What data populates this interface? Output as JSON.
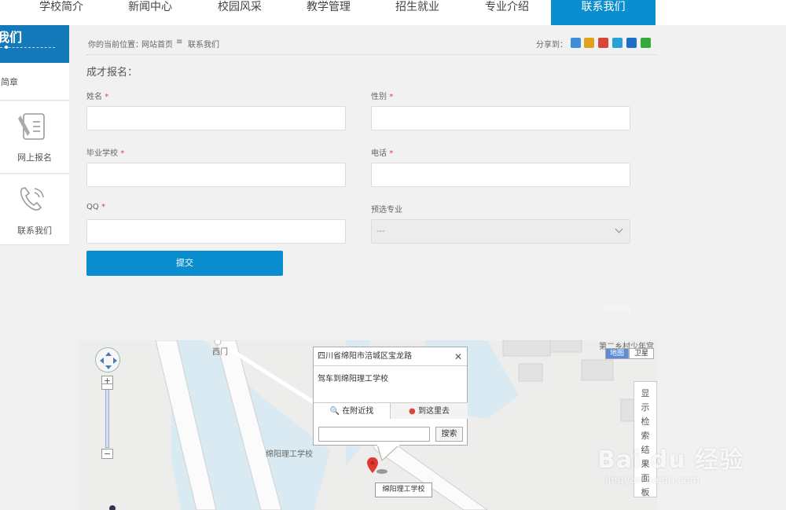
{
  "nav": {
    "items": [
      "学校简介",
      "新闻中心",
      "校园风采",
      "教学管理",
      "招生就业",
      "专业介绍",
      "联系我们"
    ],
    "active_index": 6
  },
  "sidebar": {
    "banner": "我们",
    "items": [
      {
        "label": "简章",
        "icon": "document-icon"
      },
      {
        "label": "网上报名",
        "icon": "form-pen-icon"
      },
      {
        "label": "联系我们",
        "icon": "phone-icon"
      }
    ]
  },
  "breadcrumb": {
    "prefix": "你的当前位置：",
    "home": "网站首页",
    "separator": "≡",
    "current": "联系我们",
    "share_label": "分享到：",
    "share_colors": [
      "#3f8fd8",
      "#e0a21c",
      "#d9443b",
      "#2a9fd6",
      "#1f6fc6",
      "#36a93c"
    ]
  },
  "form": {
    "title": "成才报名：",
    "fields": {
      "name": {
        "label": "姓名",
        "required": "*",
        "value": ""
      },
      "gender": {
        "label": "性别",
        "required": "*",
        "value": ""
      },
      "school": {
        "label": "毕业学校",
        "required": "*",
        "value": ""
      },
      "phone": {
        "label": "电话",
        "required": "*",
        "value": ""
      },
      "qq": {
        "label": "QQ",
        "required": "*",
        "value": ""
      },
      "major": {
        "label": "预选专业",
        "selected": "---"
      }
    },
    "submit_label": "提交",
    "faint_text": "示机网站"
  },
  "map": {
    "labels": {
      "west_gate": "西门",
      "school": "绵阳理工学校",
      "poi_ne": "第二乡村少年宫"
    },
    "types": {
      "map": "地图",
      "satellite": "卫星"
    },
    "panel_toggle": "显示检索结果面板",
    "zoom_in": "+",
    "zoom_out": "−",
    "info": {
      "address": "四川省绵阳市涪城区宝龙路",
      "drive": "驾车到绵阳理工学校",
      "nearby": "在附近找",
      "go_here": "到这里去",
      "search_button": "搜索",
      "search_value": ""
    },
    "pin_label": "绵阳理工学校"
  },
  "watermark": {
    "brand": "Bai du 经验",
    "url": "jingyan.baidu.com"
  }
}
